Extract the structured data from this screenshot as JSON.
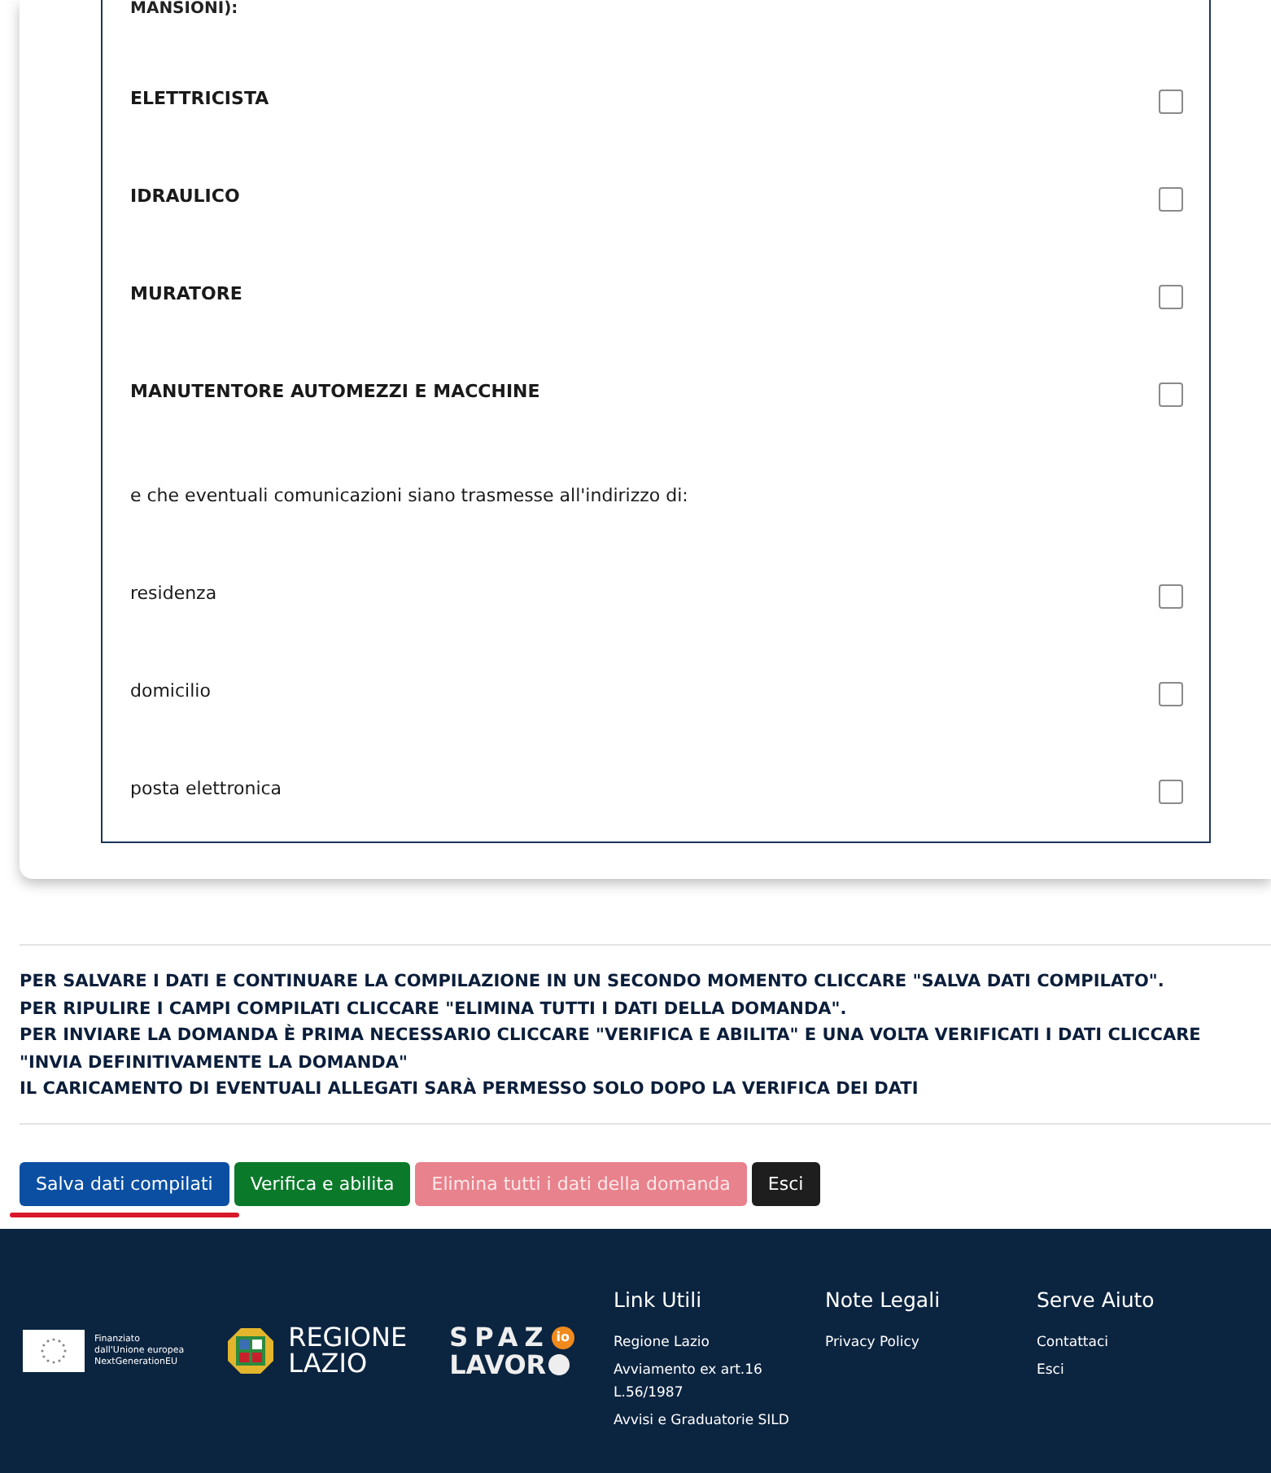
{
  "section_label": "MANSIONI):",
  "options": [
    {
      "label": "ELETTRICISTA",
      "kind": "bold",
      "checked": false
    },
    {
      "label": "IDRAULICO",
      "kind": "bold",
      "checked": false
    },
    {
      "label": "MURATORE",
      "kind": "bold",
      "checked": false
    },
    {
      "label": "MANUTENTORE AUTOMEZZI E MACCHINE",
      "kind": "bold",
      "checked": false
    },
    {
      "label": "e che eventuali comunicazioni siano trasmesse all'indirizzo di:",
      "kind": "note"
    },
    {
      "label": "residenza",
      "kind": "plain",
      "checked": false
    },
    {
      "label": "domicilio",
      "kind": "plain",
      "checked": false
    },
    {
      "label": "posta elettronica",
      "kind": "plain",
      "checked": false
    }
  ],
  "instructions": [
    "PER SALVARE I DATI E CONTINUARE LA COMPILAZIONE IN UN SECONDO MOMENTO CLICCARE \"SALVA DATI COMPILATO\".",
    "PER RIPULIRE I CAMPI COMPILATI CLICCARE \"ELIMINA TUTTI I DATI DELLA DOMANDA\".",
    "PER INVIARE LA DOMANDA È PRIMA NECESSARIO CLICCARE \"VERIFICA E ABILITA\" E UNA VOLTA VERIFICATI I DATI CLICCARE \"INVIA DEFINITIVAMENTE LA DOMANDA\"",
    "IL CARICAMENTO DI EVENTUALI ALLEGATI SARÀ PERMESSO SOLO DOPO LA VERIFICA DEI DATI"
  ],
  "buttons": [
    {
      "label": "Salva dati compilati",
      "kind": "primary",
      "selected": true
    },
    {
      "label": "Verifica e abilita",
      "kind": "success",
      "selected": false
    },
    {
      "label": "Elimina tutti i dati della domanda",
      "kind": "danger",
      "selected": false
    },
    {
      "label": "Esci",
      "kind": "dark",
      "selected": false
    }
  ],
  "footer": {
    "eu_logo": {
      "lines": [
        "Finanziato",
        "dall'Unione europea",
        "NextGenerationEU"
      ]
    },
    "region_logo": {
      "lines": [
        "REGIONE",
        "LAZIO"
      ]
    },
    "spazio_logo": {
      "top": "SPAZ",
      "badge": "io",
      "bottom": "LAVOR"
    },
    "columns": [
      {
        "title": "Link Utili",
        "links": [
          "Regione Lazio",
          "Avviamento ex art.16 L.56/1987",
          "Avvisi e Graduatorie SILD"
        ]
      },
      {
        "title": "Note Legali",
        "links": [
          "Privacy Policy"
        ]
      },
      {
        "title": "Serve Aiuto",
        "links": [
          "Contattaci",
          "Esci"
        ]
      }
    ]
  }
}
